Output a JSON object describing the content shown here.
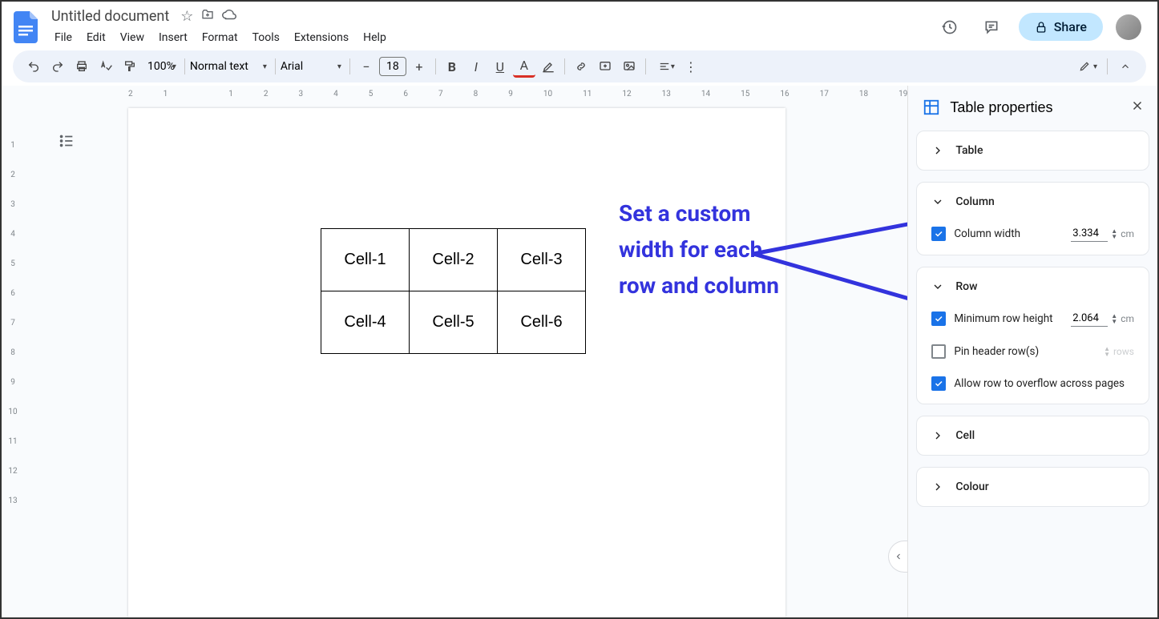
{
  "doc": {
    "title": "Untitled document"
  },
  "menus": [
    "File",
    "Edit",
    "View",
    "Insert",
    "Format",
    "Tools",
    "Extensions",
    "Help"
  ],
  "share_label": "Share",
  "toolbar": {
    "zoom": "100%",
    "paragraph_style": "Normal text",
    "font": "Arial",
    "font_size": "18"
  },
  "hruler_marks": [
    "2",
    "1",
    "",
    "1",
    "2",
    "3",
    "4",
    "5",
    "6",
    "7",
    "8",
    "9",
    "10",
    "11",
    "12",
    "13",
    "14",
    "15",
    "16",
    "17",
    "18",
    "19"
  ],
  "vruler_marks": [
    "",
    "1",
    "2",
    "3",
    "4",
    "5",
    "6",
    "7",
    "8",
    "9",
    "10",
    "11",
    "12",
    "13"
  ],
  "table": {
    "rows": [
      [
        "Cell-1",
        "Cell-2",
        "Cell-3"
      ],
      [
        "Cell-4",
        "Cell-5",
        "Cell-6"
      ]
    ]
  },
  "annotation": {
    "line1": "Set a custom",
    "line2": "width for each",
    "line3": "row and column"
  },
  "sidebar": {
    "title": "Table properties",
    "sections": {
      "table": "Table",
      "column": "Column",
      "row": "Row",
      "cell": "Cell",
      "colour": "Colour"
    },
    "column_width_label": "Column width",
    "column_width_value": "3.334",
    "cm_unit": "cm",
    "min_row_height_label": "Minimum row height",
    "min_row_height_value": "2.064",
    "pin_header_label": "Pin header row(s)",
    "rows_unit": "rows",
    "overflow_label": "Allow row to overflow across pages"
  }
}
